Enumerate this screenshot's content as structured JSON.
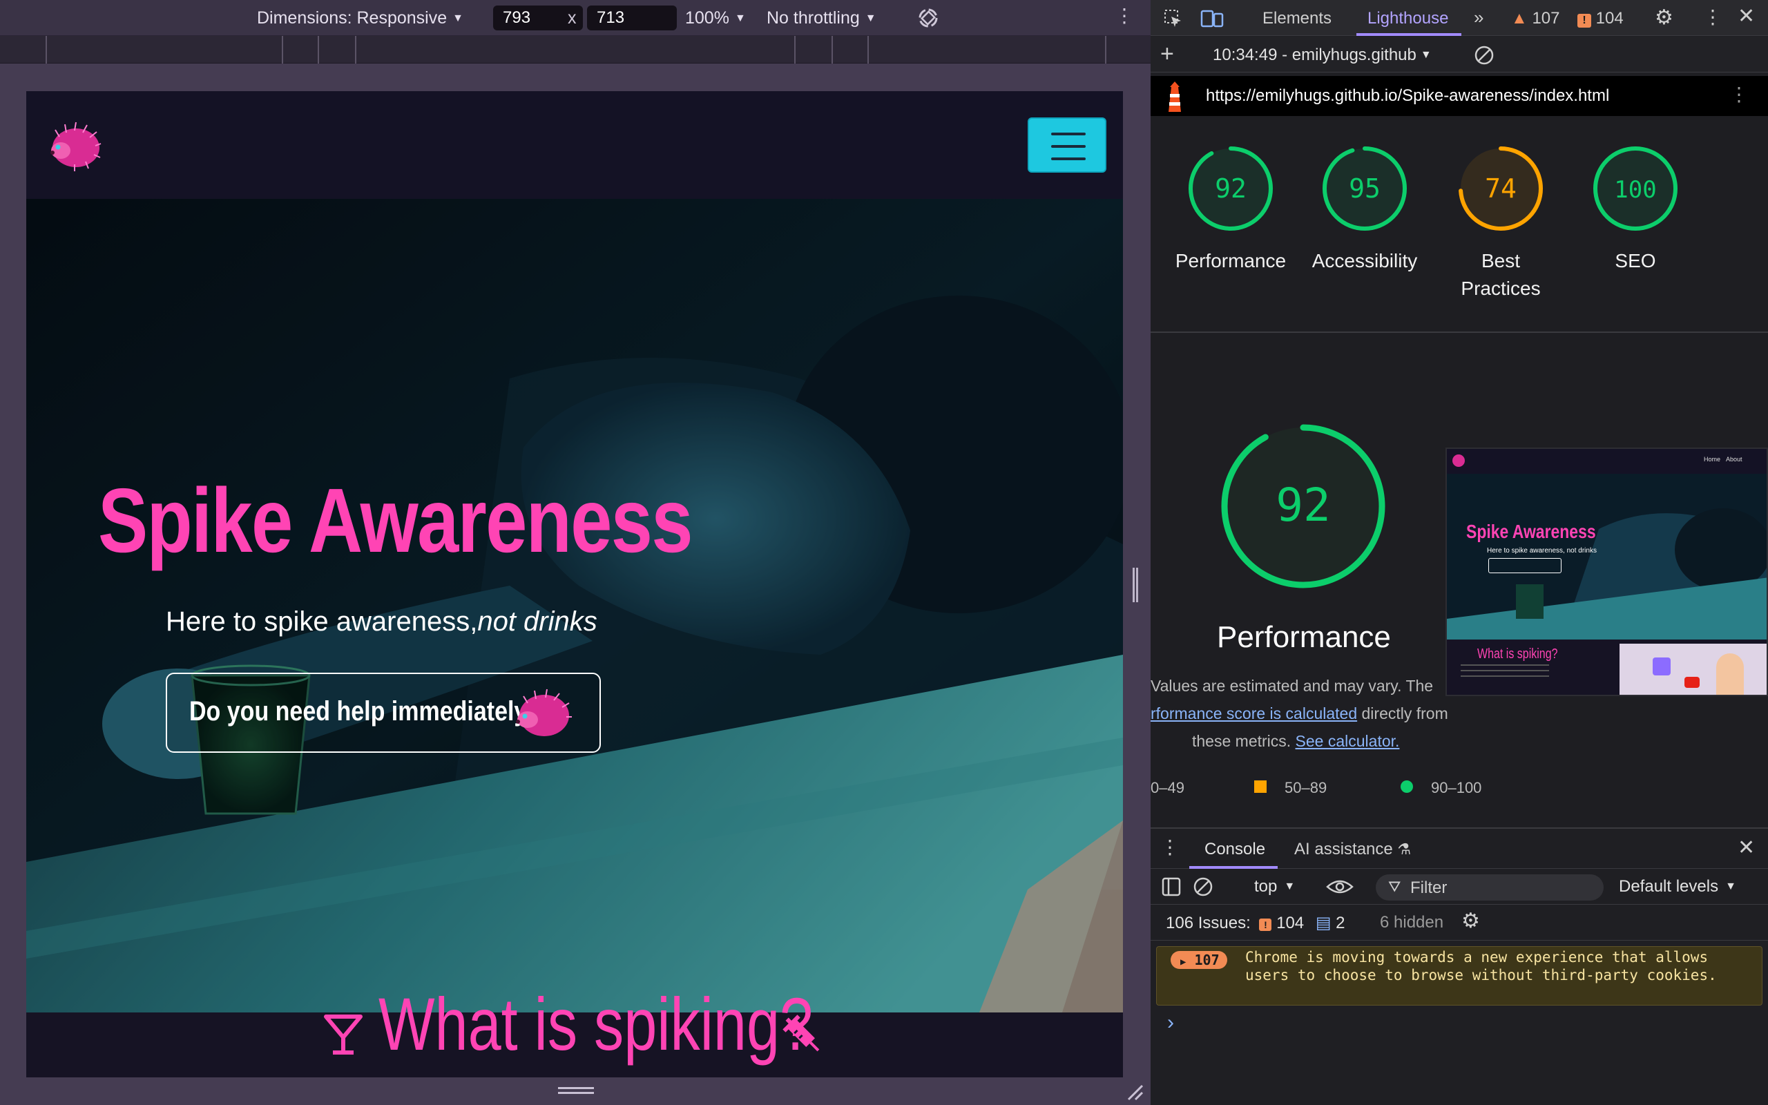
{
  "device_toolbar": {
    "dimensions_label": "Dimensions: Responsive",
    "width": "793",
    "x_sep": "x",
    "height": "713",
    "zoom": "100%",
    "throttling": "No throttling"
  },
  "site": {
    "hero": {
      "title": "Spike Awareness",
      "subtitle_plain": "Here to spike awareness,",
      "subtitle_italic": "not drinks",
      "help_button": "Do you need help immediately?"
    },
    "section_title": "What is spiking?"
  },
  "devtools": {
    "tabs": [
      "Elements",
      "Lighthouse"
    ],
    "warnings_count": "107",
    "errors_count": "104",
    "report_timestamp": "10:34:49 - emilyhugs.github",
    "url": "https://emilyhugs.github.io/Spike-awareness/index.html",
    "scores": [
      {
        "label": "Performance",
        "value": 92,
        "color": "#0cce6b"
      },
      {
        "label": "Accessibility",
        "value": 95,
        "color": "#0cce6b"
      },
      {
        "label": "Best Practices",
        "value": 74,
        "color": "#ffa400"
      },
      {
        "label": "SEO",
        "value": 100,
        "color": "#0cce6b"
      }
    ],
    "big_score": {
      "label": "Performance",
      "value": 92
    },
    "notes": {
      "line1": "Values are estimated and may vary. The",
      "line2_link": "rformance score is calculated",
      "line2_rest": " directly from",
      "line3_plain": "these metrics. ",
      "line3_link": "See calculator."
    },
    "legend": {
      "fail": "0–49",
      "average": "50–89",
      "pass": "90–100"
    },
    "thumbnail": {
      "title": "Spike Awareness",
      "subtitle": "Here to spike awareness, not drinks",
      "section": "What is spiking?",
      "nav_home": "Home",
      "nav_about": "About"
    }
  },
  "console": {
    "tabs": [
      "Console",
      "AI assistance"
    ],
    "context": "top",
    "filter_placeholder": "Filter",
    "levels": "Default levels",
    "issues_label": "106 Issues:",
    "issues_errors": "104",
    "issues_info": "2",
    "issues_hidden": "6 hidden",
    "warning_count": "107",
    "warning_message": "Chrome is moving towards a new experience that allows users to choose to browse without third-party cookies.",
    "prompt": "›"
  },
  "colors": {
    "accent_pink": "#ff44b4",
    "hamburger_cyan": "#1ec8e0",
    "lighthouse_pass": "#0cce6b",
    "lighthouse_average": "#ffa400"
  }
}
